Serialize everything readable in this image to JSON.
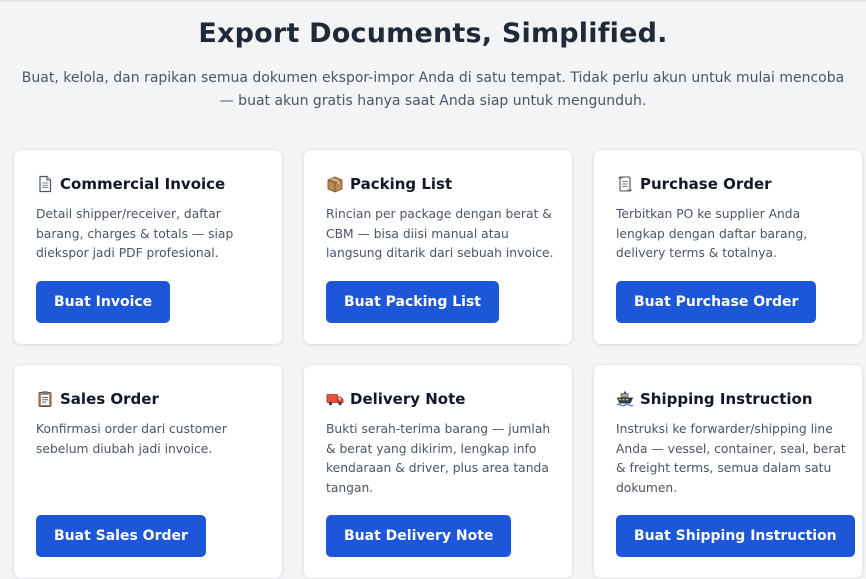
{
  "hero": {
    "title": "Export Documents, Simplified.",
    "subtitle": "Buat, kelola, dan rapikan semua dokumen ekspor-impor Anda di satu tempat. Tidak perlu akun untuk mulai mencoba — buat akun gratis hanya saat Anda siap untuk mengunduh."
  },
  "cards": [
    {
      "icon": "document-icon",
      "title": "Commercial Invoice",
      "description": "Detail shipper/receiver, daftar barang, charges & totals — siap diekspor jadi PDF profesional.",
      "button": "Buat Invoice"
    },
    {
      "icon": "package-icon",
      "title": "Packing List",
      "description": "Rincian per package dengan berat & CBM — bisa diisi manual atau langsung ditarik dari sebuah invoice.",
      "button": "Buat Packing List"
    },
    {
      "icon": "scroll-icon",
      "title": "Purchase Order",
      "description": "Terbitkan PO ke supplier Anda lengkap dengan daftar barang, delivery terms & totalnya.",
      "button": "Buat Purchase Order"
    },
    {
      "icon": "clipboard-icon",
      "title": "Sales Order",
      "description": "Konfirmasi order dari customer sebelum diubah jadi invoice.",
      "button": "Buat Sales Order"
    },
    {
      "icon": "truck-icon",
      "title": "Delivery Note",
      "description": "Bukti serah-terima barang — jumlah & berat yang dikirim, lengkap info kendaraan & driver, plus area tanda tangan.",
      "button": "Buat Delivery Note"
    },
    {
      "icon": "ship-icon",
      "title": "Shipping Instruction",
      "description": "Instruksi ke forwarder/shipping line Anda — vessel, container, seal, berat & freight terms, semua dalam satu dokumen.",
      "button": "Buat Shipping Instruction"
    }
  ]
}
